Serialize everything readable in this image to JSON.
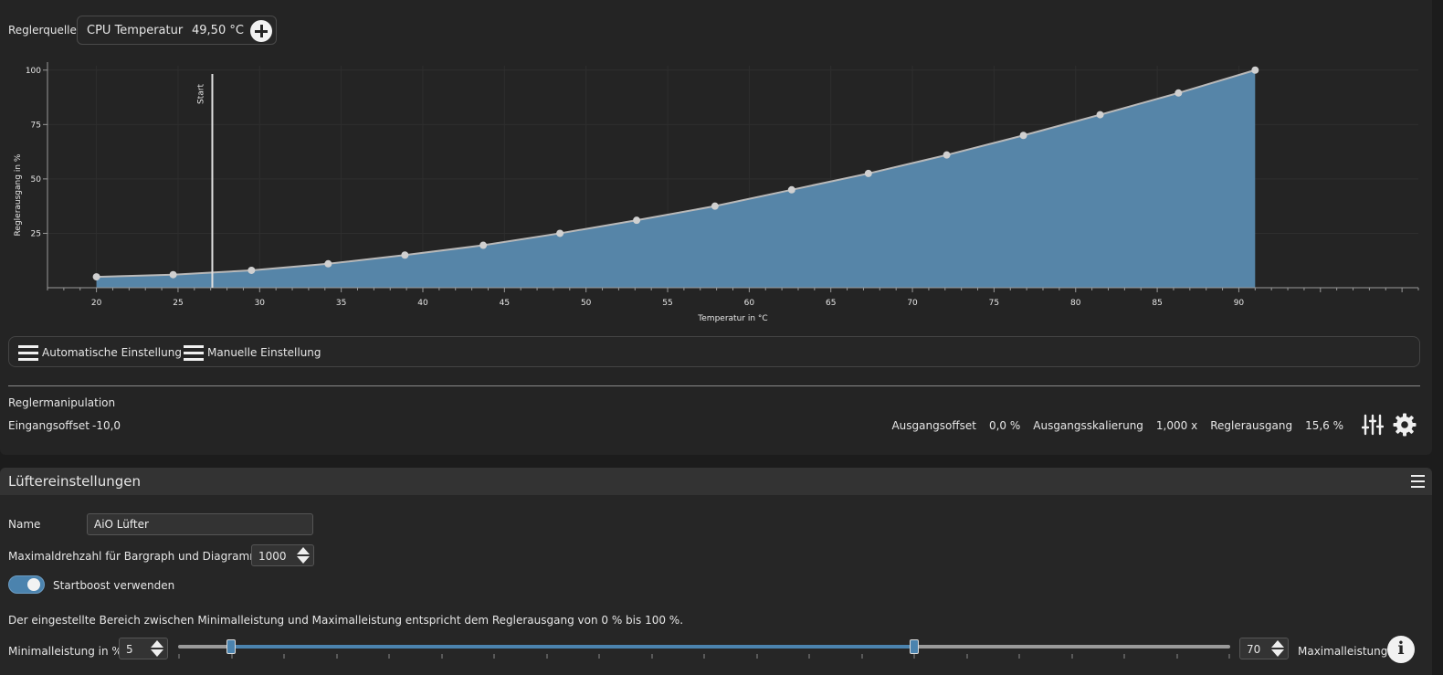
{
  "source": {
    "label": "Reglerquelle",
    "name": "CPU Temperatur",
    "value": "49,50 °C"
  },
  "chart_data": {
    "type": "area",
    "xlabel": "Temperatur in °C",
    "ylabel": "Reglerausgang in %",
    "xlim": [
      17,
      101
    ],
    "ylim": [
      0,
      102
    ],
    "x_ticks": [
      20,
      25,
      30,
      35,
      40,
      45,
      50,
      55,
      60,
      65,
      70,
      75,
      80,
      85,
      90
    ],
    "y_ticks": [
      25,
      50,
      75,
      100
    ],
    "grid": true,
    "marker": {
      "label": "Start",
      "x": 27.1
    },
    "series": [
      {
        "x": [
          20,
          24.7,
          29.5,
          34.2,
          38.9,
          43.7,
          48.4,
          53.1,
          57.9,
          62.6,
          67.3,
          72.1,
          76.8,
          81.5,
          86.3,
          91
        ],
        "values": [
          5,
          6,
          8,
          11,
          15,
          19.5,
          25,
          31,
          37.5,
          45,
          52.5,
          61,
          70,
          79.5,
          89.5,
          100
        ]
      }
    ],
    "colors": {
      "fill": "#5685a8",
      "line": "#b9b9b9",
      "point": "#d0d0d0"
    }
  },
  "modes": {
    "auto": "Automatische Einstellung",
    "manual": "Manuelle Einstellung"
  },
  "manipulation": {
    "title": "Reglermanipulation",
    "input_offset_label": "Eingangsoffset",
    "input_offset_value": "-10,0",
    "output_offset_label": "Ausgangsoffset",
    "output_offset_value": "0,0 %",
    "output_scaling_label": "Ausgangsskalierung",
    "output_scaling_value": "1,000 x",
    "output_label": "Reglerausgang",
    "output_value": "15,6 %"
  },
  "fan": {
    "title": "Lüftereinstellungen",
    "name_label": "Name",
    "name_value": "AiO Lüfter",
    "max_rpm_label": "Maximaldrehzahl für Bargraph und Diagramm",
    "max_rpm_value": "1000",
    "startboost_label": "Startboost verwenden",
    "startboost_on": true,
    "range_note": "Der eingestellte Bereich zwischen Minimalleistung und Maximalleistung entspricht dem Reglerausgang von 0 % bis 100 %.",
    "min_label": "Minimalleistung in %",
    "min_value": "5",
    "max_value": "70",
    "max_label": "Maximalleistung",
    "range_min_pct": 5,
    "range_max_pct": 70
  },
  "colors": {
    "accent": "#4b83ae",
    "background": "#242424"
  }
}
